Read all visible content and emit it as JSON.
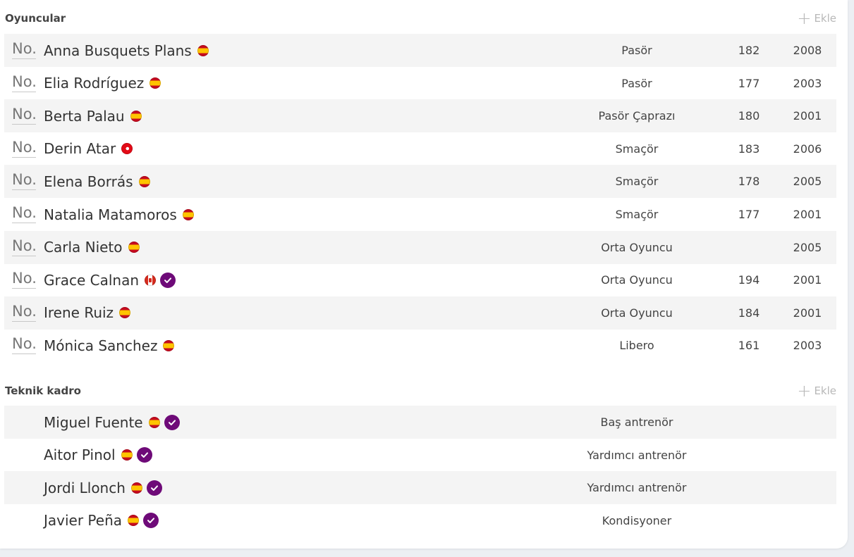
{
  "players": {
    "title": "Oyuncular",
    "add_label": "Ekle",
    "number_placeholder": "No.",
    "rows": [
      {
        "name": "Anna Busquets Plans",
        "flag": "es",
        "verified": false,
        "position": "Pasör",
        "height": "182",
        "year": "2008"
      },
      {
        "name": "Elia Rodríguez",
        "flag": "es",
        "verified": false,
        "position": "Pasör",
        "height": "177",
        "year": "2003"
      },
      {
        "name": "Berta Palau",
        "flag": "es",
        "verified": false,
        "position": "Pasör Çaprazı",
        "height": "180",
        "year": "2001"
      },
      {
        "name": "Derin Atar",
        "flag": "tr",
        "verified": false,
        "position": "Smaçör",
        "height": "183",
        "year": "2006"
      },
      {
        "name": "Elena Borrás",
        "flag": "es",
        "verified": false,
        "position": "Smaçör",
        "height": "178",
        "year": "2005"
      },
      {
        "name": "Natalia Matamoros",
        "flag": "es",
        "verified": false,
        "position": "Smaçör",
        "height": "177",
        "year": "2001"
      },
      {
        "name": "Carla Nieto",
        "flag": "es",
        "verified": false,
        "position": "Orta Oyuncu",
        "height": "",
        "year": "2005"
      },
      {
        "name": "Grace Calnan",
        "flag": "ca",
        "verified": true,
        "position": "Orta Oyuncu",
        "height": "194",
        "year": "2001"
      },
      {
        "name": "Irene Ruiz",
        "flag": "es",
        "verified": false,
        "position": "Orta Oyuncu",
        "height": "184",
        "year": "2001"
      },
      {
        "name": "Mónica Sanchez",
        "flag": "es",
        "verified": false,
        "position": "Libero",
        "height": "161",
        "year": "2003"
      }
    ]
  },
  "staff": {
    "title": "Teknik kadro",
    "add_label": "Ekle",
    "rows": [
      {
        "name": "Miguel Fuente",
        "flag": "es",
        "verified": true,
        "role": "Baş antrenör"
      },
      {
        "name": "Aitor Pinol",
        "flag": "es",
        "verified": true,
        "role": "Yardımcı antrenör"
      },
      {
        "name": "Jordi Llonch",
        "flag": "es",
        "verified": true,
        "role": "Yardımcı antrenör"
      },
      {
        "name": "Javier Peña",
        "flag": "es",
        "verified": true,
        "role": "Kondisyoner"
      }
    ]
  },
  "icons": {
    "add": "plus-icon",
    "verified": "check-circle-icon",
    "flags": [
      "spain-flag-icon",
      "turkey-flag-icon",
      "canada-flag-icon"
    ]
  },
  "colors": {
    "verified": "#6e0a78",
    "row_alt": "#f4f4f4",
    "add_muted": "#b8b8b8"
  }
}
